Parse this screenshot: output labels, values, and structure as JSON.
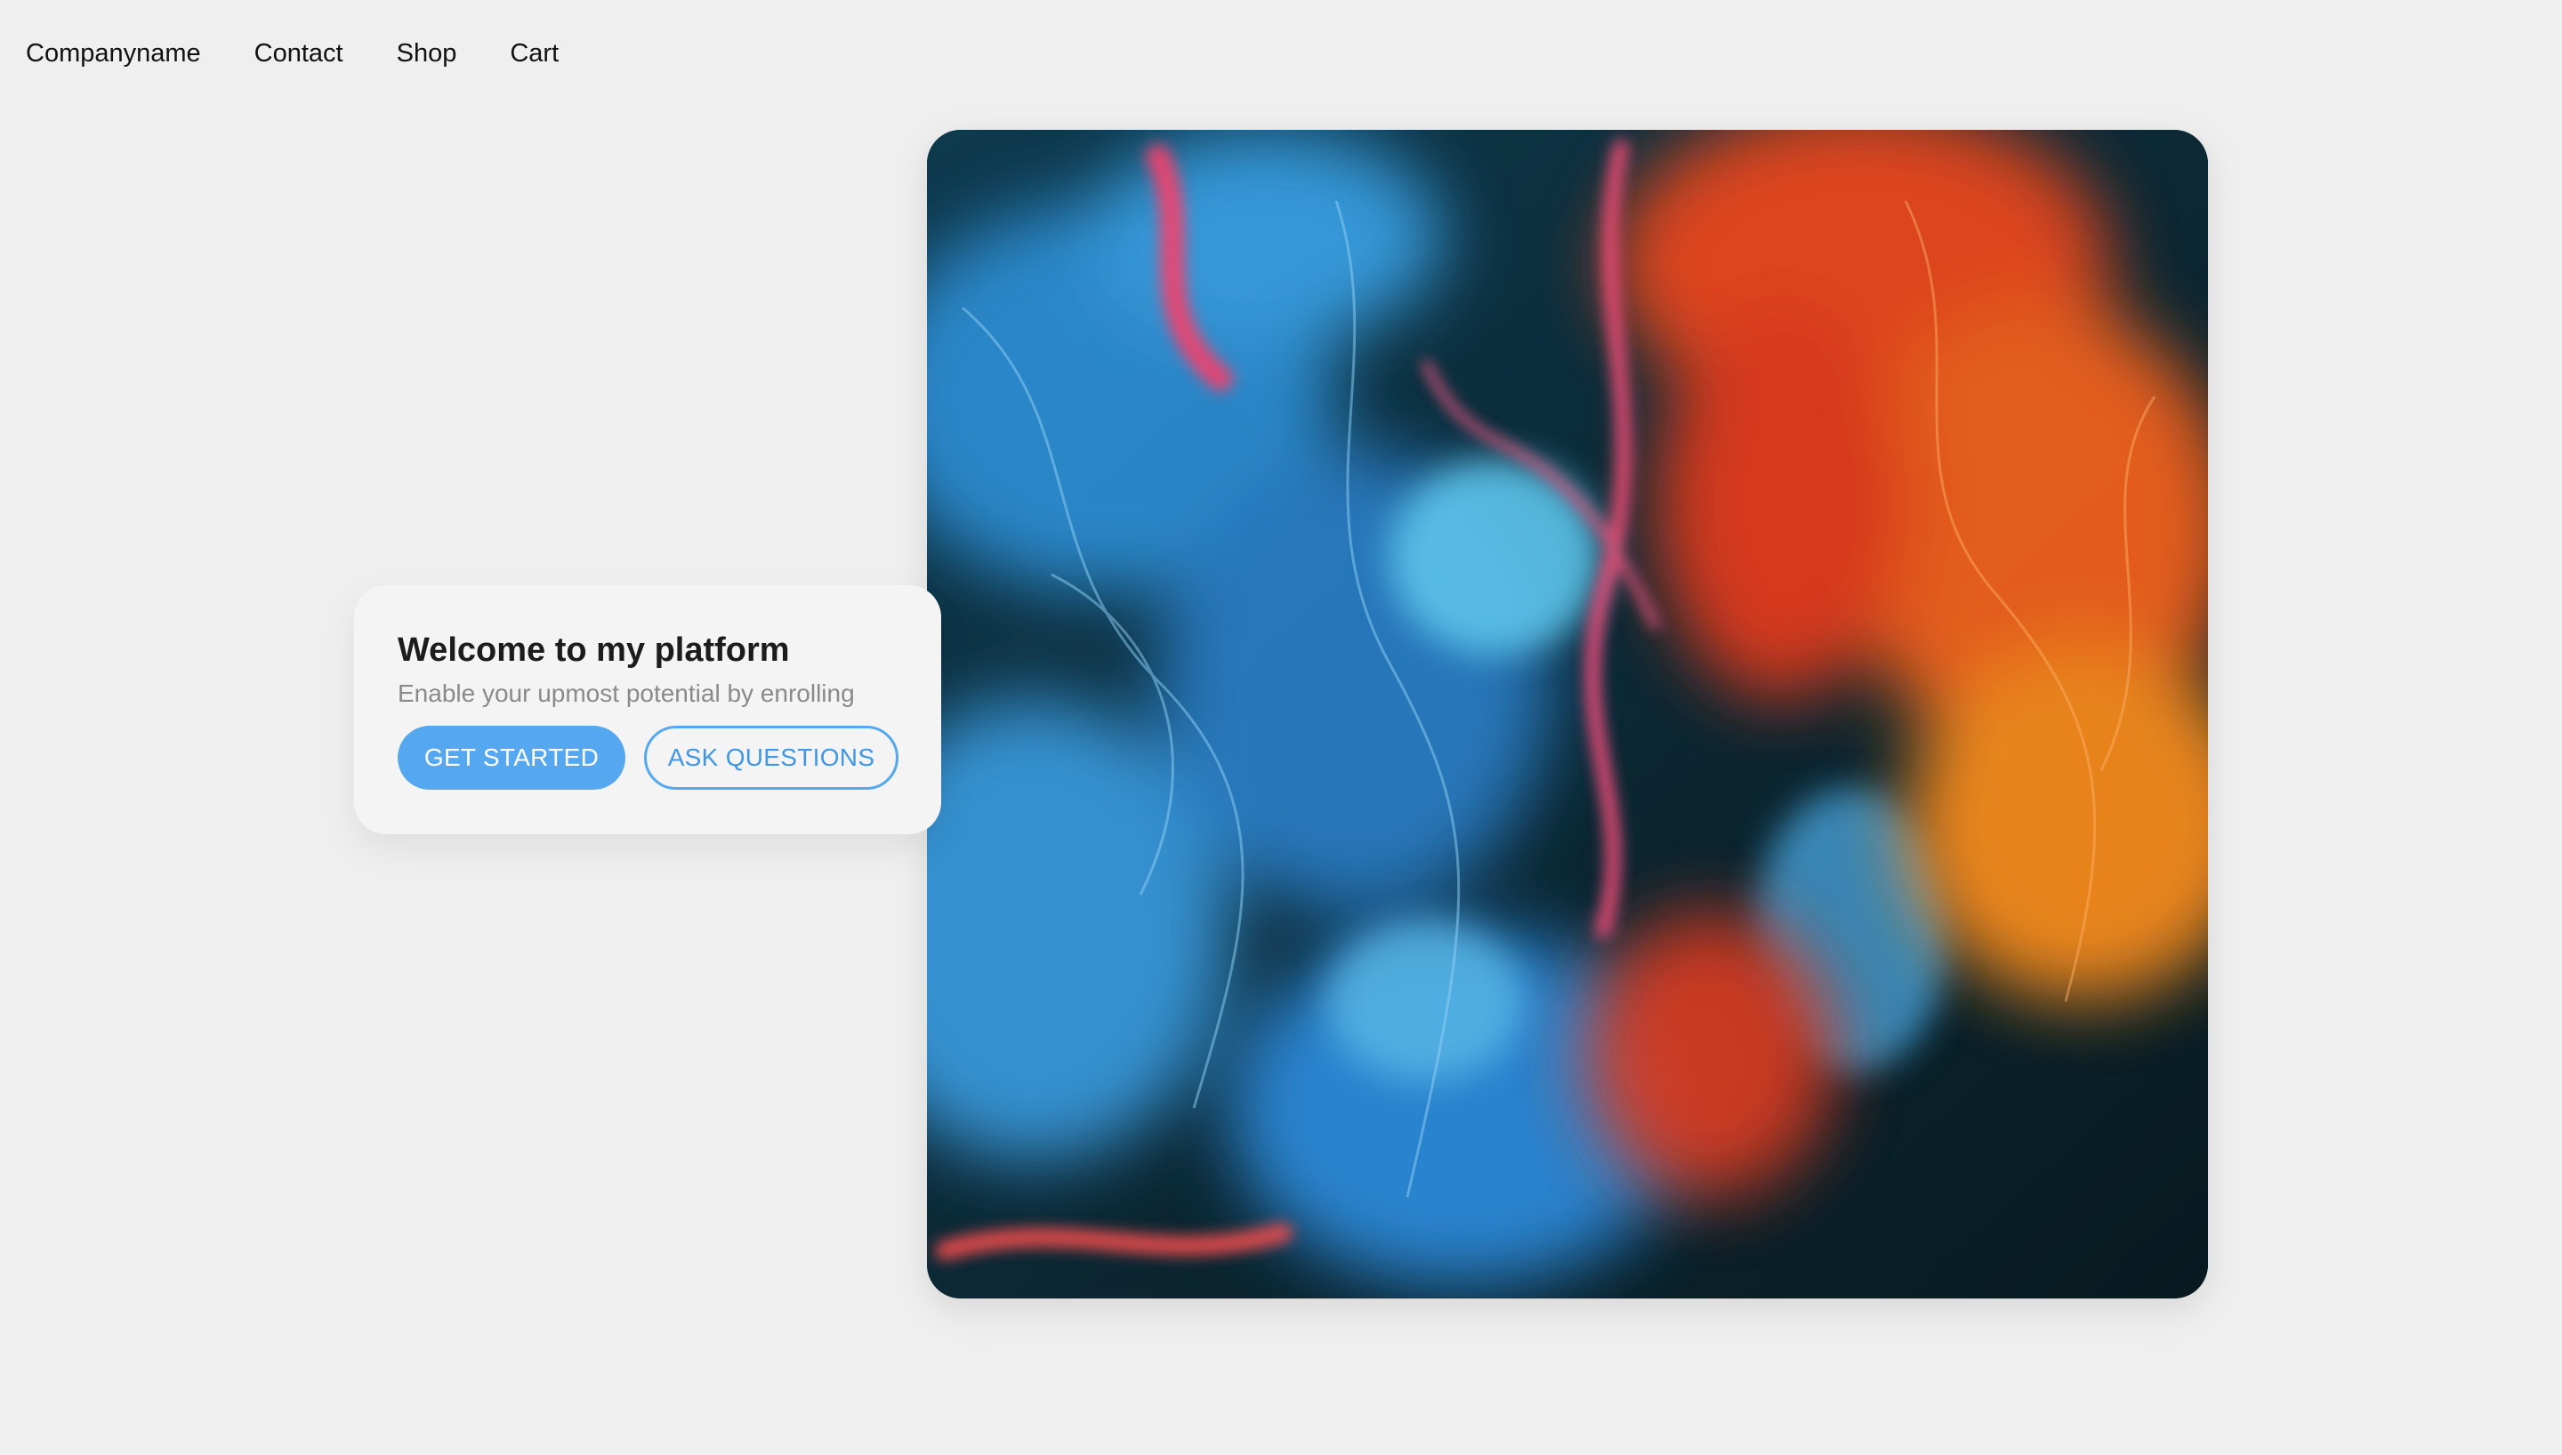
{
  "nav": {
    "brand": "Companyname",
    "links": [
      "Contact",
      "Shop",
      "Cart"
    ]
  },
  "card": {
    "title": "Welcome to my platform",
    "subtitle": "Enable your upmost potential by enrolling",
    "primary_button": "GET STARTED",
    "secondary_button": "ASK QUESTIONS"
  },
  "colors": {
    "background": "#efefef",
    "accent": "#55a8ef",
    "card_background": "#f4f4f4"
  }
}
